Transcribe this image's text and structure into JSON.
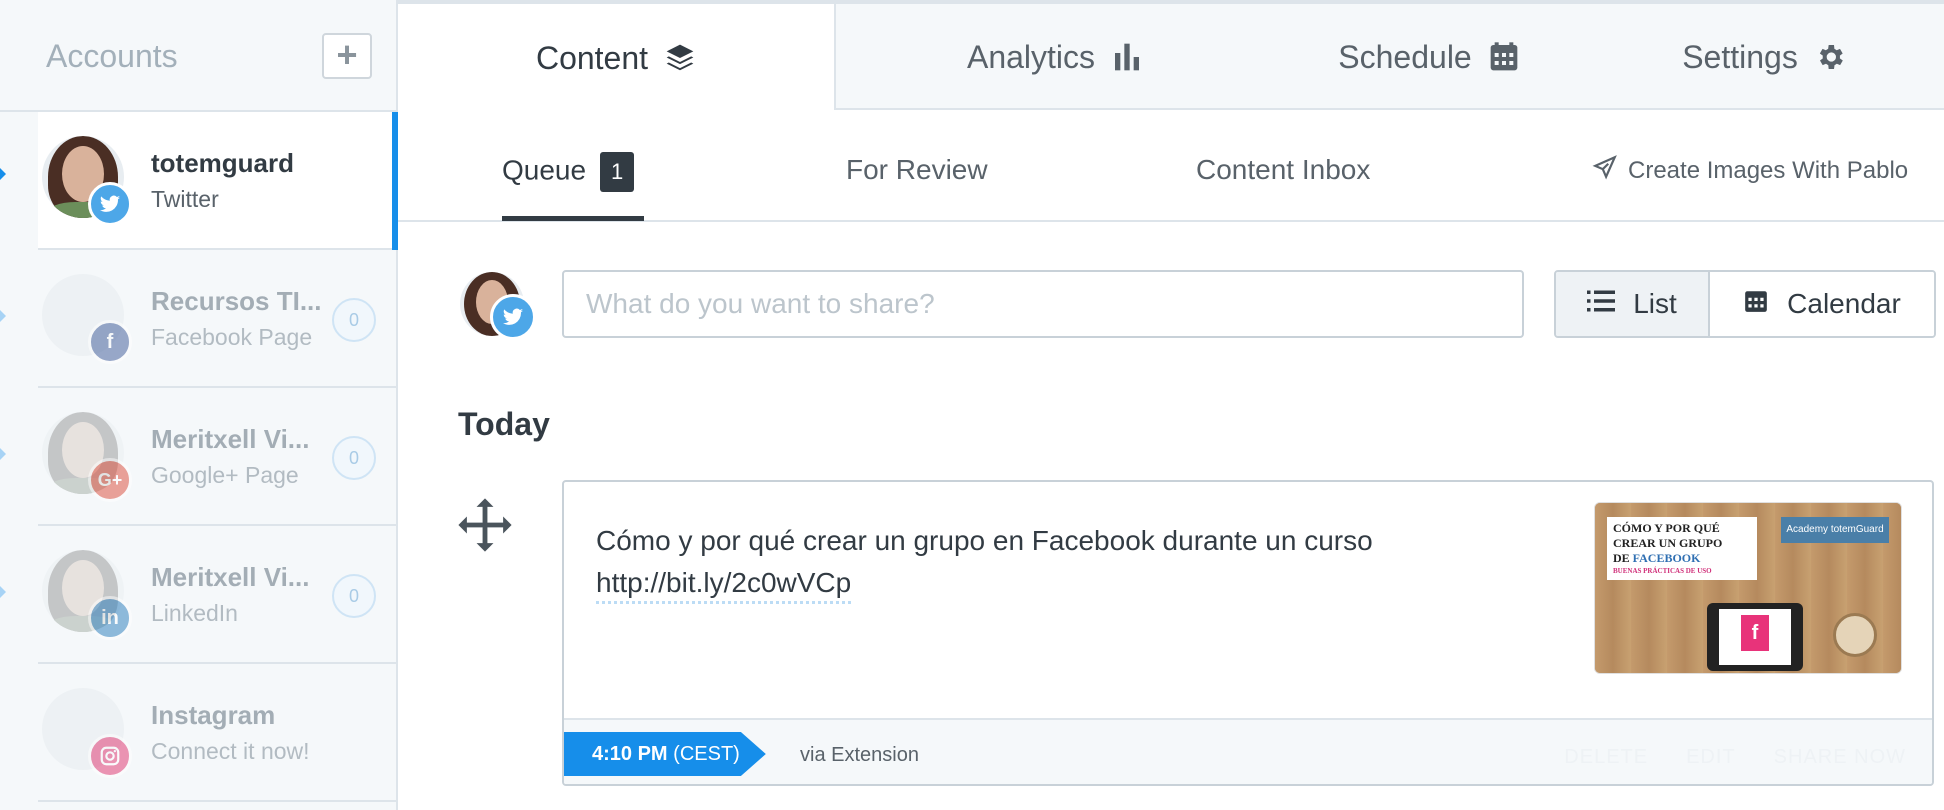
{
  "sidebar": {
    "title": "Accounts",
    "add_label": "+",
    "accounts": [
      {
        "name": "totemguard",
        "type": "Twitter",
        "network": "twitter",
        "count": "",
        "color": "#4da7e8"
      },
      {
        "name": "Recursos TI...",
        "type": "Facebook Page",
        "network": "facebook",
        "count": "0",
        "color": "#3b5998"
      },
      {
        "name": "Meritxell Vi...",
        "type": "Google+ Page",
        "network": "google-plus",
        "count": "0",
        "color": "#dd4b39"
      },
      {
        "name": "Meritxell Vi...",
        "type": "LinkedIn",
        "network": "linkedin",
        "count": "0",
        "color": "#287bbc"
      },
      {
        "name": "Instagram",
        "type": "Connect it now!",
        "network": "instagram",
        "count": "",
        "color": "#e1306c"
      }
    ]
  },
  "main_tabs": [
    {
      "label": "Content",
      "icon": "layers-icon"
    },
    {
      "label": "Analytics",
      "icon": "bar-chart-icon"
    },
    {
      "label": "Schedule",
      "icon": "calendar-icon"
    },
    {
      "label": "Settings",
      "icon": "gear-icon"
    }
  ],
  "sub_tabs": {
    "queue": "Queue",
    "queue_count": "1",
    "review": "For Review",
    "inbox": "Content Inbox",
    "pablo": "Create Images With Pablo"
  },
  "composer": {
    "placeholder": "What do you want to share?",
    "list_label": "List",
    "calendar_label": "Calendar"
  },
  "day_heading": "Today",
  "post": {
    "text": "Cómo y por qué crear un grupo en Facebook durante un curso",
    "link": "http://bit.ly/2c0wVCp",
    "thumb": {
      "line1": "CÓMO Y POR QUÉ",
      "line2": "CREAR UN GRUPO",
      "line3_pre": "DE ",
      "line3_fb": "FACEBOOK",
      "line4": "BUENAS PRÁCTICAS DE USO",
      "brand": "Academy totemGuard",
      "f": "f"
    },
    "time": "4:10 PM",
    "tz": "(CEST)",
    "via": "via Extension",
    "actions": [
      "DELETE",
      "EDIT",
      "SHARE NOW"
    ]
  },
  "colors": {
    "accent": "#168eea",
    "text": "#323b43",
    "muted": "#59626a",
    "border": "#dde4ea"
  }
}
